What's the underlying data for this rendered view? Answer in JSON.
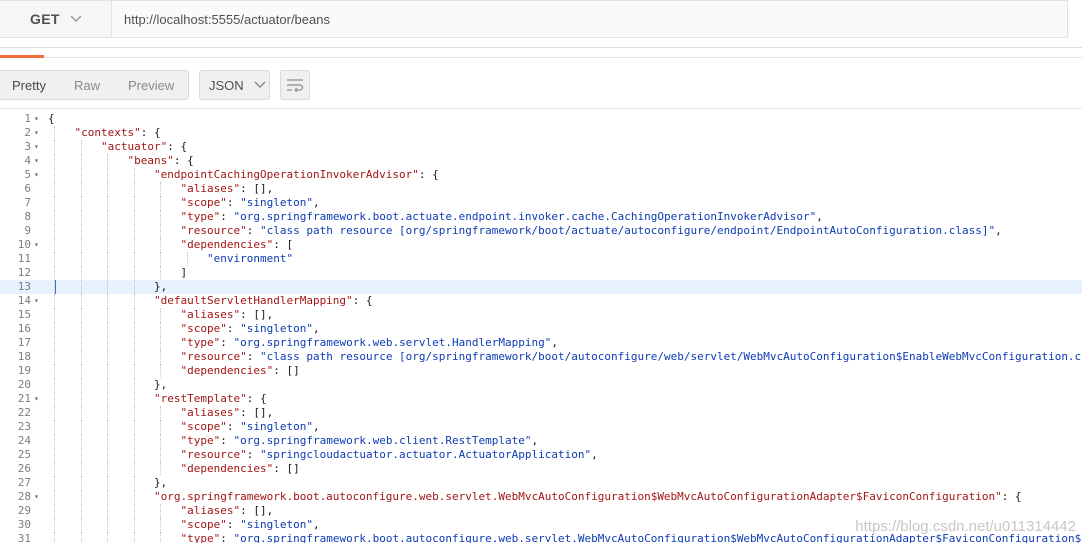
{
  "request": {
    "method": "GET",
    "url": "http://localhost:5555/actuator/beans"
  },
  "toolbar": {
    "view_tabs": [
      "Pretty",
      "Raw",
      "Preview"
    ],
    "active_tab": "Pretty",
    "format": "JSON",
    "wrap_icon": "wrap-lines-icon"
  },
  "editor": {
    "highlighted_line": 13,
    "lines": [
      {
        "n": "1",
        "fold": true,
        "indent": 0,
        "tokens": [
          [
            "p",
            "{"
          ]
        ]
      },
      {
        "n": "2",
        "fold": true,
        "indent": 1,
        "tokens": [
          [
            "k",
            "\"contexts\""
          ],
          [
            "p",
            ": {"
          ]
        ]
      },
      {
        "n": "3",
        "fold": true,
        "indent": 2,
        "tokens": [
          [
            "k",
            "\"actuator\""
          ],
          [
            "p",
            ": {"
          ]
        ]
      },
      {
        "n": "4",
        "fold": true,
        "indent": 3,
        "tokens": [
          [
            "k",
            "\"beans\""
          ],
          [
            "p",
            ": {"
          ]
        ]
      },
      {
        "n": "5",
        "fold": true,
        "indent": 4,
        "tokens": [
          [
            "k",
            "\"endpointCachingOperationInvokerAdvisor\""
          ],
          [
            "p",
            ": {"
          ]
        ]
      },
      {
        "n": "6",
        "fold": false,
        "indent": 5,
        "tokens": [
          [
            "k",
            "\"aliases\""
          ],
          [
            "p",
            ": [],"
          ]
        ]
      },
      {
        "n": "7",
        "fold": false,
        "indent": 5,
        "tokens": [
          [
            "k",
            "\"scope\""
          ],
          [
            "p",
            ": "
          ],
          [
            "s",
            "\"singleton\""
          ],
          [
            "p",
            ","
          ]
        ]
      },
      {
        "n": "8",
        "fold": false,
        "indent": 5,
        "tokens": [
          [
            "k",
            "\"type\""
          ],
          [
            "p",
            ": "
          ],
          [
            "s",
            "\"org.springframework.boot.actuate.endpoint.invoker.cache.CachingOperationInvokerAdvisor\""
          ],
          [
            "p",
            ","
          ]
        ]
      },
      {
        "n": "9",
        "fold": false,
        "indent": 5,
        "tokens": [
          [
            "k",
            "\"resource\""
          ],
          [
            "p",
            ": "
          ],
          [
            "s",
            "\"class path resource [org/springframework/boot/actuate/autoconfigure/endpoint/EndpointAutoConfiguration.class]\""
          ],
          [
            "p",
            ","
          ]
        ]
      },
      {
        "n": "10",
        "fold": true,
        "indent": 5,
        "tokens": [
          [
            "k",
            "\"dependencies\""
          ],
          [
            "p",
            ": ["
          ]
        ]
      },
      {
        "n": "11",
        "fold": false,
        "indent": 6,
        "tokens": [
          [
            "s",
            "\"environment\""
          ]
        ]
      },
      {
        "n": "12",
        "fold": false,
        "indent": 5,
        "tokens": [
          [
            "p",
            "]"
          ]
        ]
      },
      {
        "n": "13",
        "fold": false,
        "indent": 4,
        "tokens": [
          [
            "p",
            "},"
          ]
        ]
      },
      {
        "n": "14",
        "fold": true,
        "indent": 4,
        "tokens": [
          [
            "k",
            "\"defaultServletHandlerMapping\""
          ],
          [
            "p",
            ": {"
          ]
        ]
      },
      {
        "n": "15",
        "fold": false,
        "indent": 5,
        "tokens": [
          [
            "k",
            "\"aliases\""
          ],
          [
            "p",
            ": [],"
          ]
        ]
      },
      {
        "n": "16",
        "fold": false,
        "indent": 5,
        "tokens": [
          [
            "k",
            "\"scope\""
          ],
          [
            "p",
            ": "
          ],
          [
            "s",
            "\"singleton\""
          ],
          [
            "p",
            ","
          ]
        ]
      },
      {
        "n": "17",
        "fold": false,
        "indent": 5,
        "tokens": [
          [
            "k",
            "\"type\""
          ],
          [
            "p",
            ": "
          ],
          [
            "s",
            "\"org.springframework.web.servlet.HandlerMapping\""
          ],
          [
            "p",
            ","
          ]
        ]
      },
      {
        "n": "18",
        "fold": false,
        "indent": 5,
        "tokens": [
          [
            "k",
            "\"resource\""
          ],
          [
            "p",
            ": "
          ],
          [
            "s",
            "\"class path resource [org/springframework/boot/autoconfigure/web/servlet/WebMvcAutoConfiguration$EnableWebMvcConfiguration.cl"
          ]
        ]
      },
      {
        "n": "19",
        "fold": false,
        "indent": 5,
        "tokens": [
          [
            "k",
            "\"dependencies\""
          ],
          [
            "p",
            ": []"
          ]
        ]
      },
      {
        "n": "20",
        "fold": false,
        "indent": 4,
        "tokens": [
          [
            "p",
            "},"
          ]
        ]
      },
      {
        "n": "21",
        "fold": true,
        "indent": 4,
        "tokens": [
          [
            "k",
            "\"restTemplate\""
          ],
          [
            "p",
            ": {"
          ]
        ]
      },
      {
        "n": "22",
        "fold": false,
        "indent": 5,
        "tokens": [
          [
            "k",
            "\"aliases\""
          ],
          [
            "p",
            ": [],"
          ]
        ]
      },
      {
        "n": "23",
        "fold": false,
        "indent": 5,
        "tokens": [
          [
            "k",
            "\"scope\""
          ],
          [
            "p",
            ": "
          ],
          [
            "s",
            "\"singleton\""
          ],
          [
            "p",
            ","
          ]
        ]
      },
      {
        "n": "24",
        "fold": false,
        "indent": 5,
        "tokens": [
          [
            "k",
            "\"type\""
          ],
          [
            "p",
            ": "
          ],
          [
            "s",
            "\"org.springframework.web.client.RestTemplate\""
          ],
          [
            "p",
            ","
          ]
        ]
      },
      {
        "n": "25",
        "fold": false,
        "indent": 5,
        "tokens": [
          [
            "k",
            "\"resource\""
          ],
          [
            "p",
            ": "
          ],
          [
            "s",
            "\"springcloudactuator.actuator.ActuatorApplication\""
          ],
          [
            "p",
            ","
          ]
        ]
      },
      {
        "n": "26",
        "fold": false,
        "indent": 5,
        "tokens": [
          [
            "k",
            "\"dependencies\""
          ],
          [
            "p",
            ": []"
          ]
        ]
      },
      {
        "n": "27",
        "fold": false,
        "indent": 4,
        "tokens": [
          [
            "p",
            "},"
          ]
        ]
      },
      {
        "n": "28",
        "fold": true,
        "indent": 4,
        "tokens": [
          [
            "k",
            "\"org.springframework.boot.autoconfigure.web.servlet.WebMvcAutoConfiguration$WebMvcAutoConfigurationAdapter$FaviconConfiguration\""
          ],
          [
            "p",
            ": {"
          ]
        ]
      },
      {
        "n": "29",
        "fold": false,
        "indent": 5,
        "tokens": [
          [
            "k",
            "\"aliases\""
          ],
          [
            "p",
            ": [],"
          ]
        ]
      },
      {
        "n": "30",
        "fold": false,
        "indent": 5,
        "tokens": [
          [
            "k",
            "\"scope\""
          ],
          [
            "p",
            ": "
          ],
          [
            "s",
            "\"singleton\""
          ],
          [
            "p",
            ","
          ]
        ]
      },
      {
        "n": "31",
        "fold": false,
        "indent": 5,
        "tokens": [
          [
            "k",
            "\"type\""
          ],
          [
            "p",
            ": "
          ],
          [
            "s",
            "\"org.springframework.boot.autoconfigure.web.servlet.WebMvcAutoConfiguration$WebMvcAutoConfigurationAdapter$FaviconConfiguration$"
          ]
        ]
      }
    ]
  },
  "watermark": "https://blog.csdn.net/u011314442",
  "colors": {
    "key": "#a31515",
    "string": "#0d3cb4",
    "accent": "#f26b3a",
    "highlight": "#e8f2fe"
  }
}
